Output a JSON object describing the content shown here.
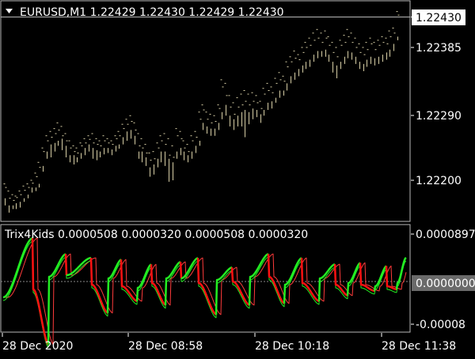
{
  "main_chart": {
    "menu_icon": "triangle-down-icon",
    "title": "EURUSD,M1  1.22429 1.22430 1.22429 1.22430",
    "current_price": "1.22430",
    "price_ticks": [
      "1.22385",
      "1.22290",
      "1.22200"
    ],
    "colors": {
      "bars": "#d8cfa6",
      "border": "#b9b9b9",
      "price_box": "#ffffff"
    },
    "bars": [
      [
        1.22195,
        1.22175,
        1.22165,
        1.2219
      ],
      [
        1.22185,
        1.22165,
        1.22155,
        1.22175
      ],
      [
        1.2218,
        1.22165,
        1.2216,
        1.22172
      ],
      [
        1.22178,
        1.22168,
        1.2216,
        1.22176
      ],
      [
        1.22185,
        1.2217,
        1.22162,
        1.2218
      ],
      [
        1.22192,
        1.22175,
        1.2217,
        1.22186
      ],
      [
        1.22195,
        1.2218,
        1.22175,
        1.2219
      ],
      [
        1.222,
        1.2219,
        1.22183,
        1.22196
      ],
      [
        1.2221,
        1.2219,
        1.22185,
        1.22205
      ],
      [
        1.22225,
        1.22195,
        1.2219,
        1.22218
      ],
      [
        1.22245,
        1.2222,
        1.22212,
        1.2224
      ],
      [
        1.22262,
        1.2224,
        1.2223,
        1.22255
      ],
      [
        1.22268,
        1.2225,
        1.22232,
        1.2226
      ],
      [
        1.22272,
        1.22252,
        1.2224,
        1.22265
      ],
      [
        1.2228,
        1.22255,
        1.22248,
        1.2227
      ],
      [
        1.22275,
        1.22258,
        1.22242,
        1.22262
      ],
      [
        1.22265,
        1.22248,
        1.22232,
        1.22255
      ],
      [
        1.22255,
        1.22235,
        1.22225,
        1.22245
      ],
      [
        1.22248,
        1.22235,
        1.22222,
        1.2224
      ],
      [
        1.22245,
        1.22232,
        1.22225,
        1.22238
      ],
      [
        1.22252,
        1.22238,
        1.2223,
        1.22248
      ],
      [
        1.22258,
        1.22245,
        1.22235,
        1.22252
      ],
      [
        1.22262,
        1.2225,
        1.2224,
        1.22257
      ],
      [
        1.22265,
        1.22245,
        1.2223,
        1.22252
      ],
      [
        1.22258,
        1.22242,
        1.22228,
        1.2225
      ],
      [
        1.22255,
        1.2224,
        1.22232,
        1.22248
      ],
      [
        1.22262,
        1.22245,
        1.22236,
        1.22255
      ],
      [
        1.22258,
        1.22245,
        1.22238,
        1.22252
      ],
      [
        1.22255,
        1.22243,
        1.22235,
        1.2225
      ],
      [
        1.22262,
        1.22248,
        1.2224,
        1.22258
      ],
      [
        1.22268,
        1.2225,
        1.22244,
        1.22262
      ],
      [
        1.22278,
        1.2226,
        1.2225,
        1.22272
      ],
      [
        1.22285,
        1.22268,
        1.22255,
        1.22278
      ],
      [
        1.2229,
        1.2227,
        1.22258,
        1.22282
      ],
      [
        1.2228,
        1.22262,
        1.2225,
        1.2227
      ],
      [
        1.22265,
        1.2224,
        1.2223,
        1.22248
      ],
      [
        1.22258,
        1.2224,
        1.22225,
        1.22245
      ],
      [
        1.2225,
        1.22232,
        1.2222,
        1.22238
      ],
      [
        1.22238,
        1.22218,
        1.22205,
        1.22228
      ],
      [
        1.2224,
        1.22222,
        1.22208,
        1.2223
      ],
      [
        1.22252,
        1.2223,
        1.22218,
        1.22245
      ],
      [
        1.22262,
        1.2224,
        1.22225,
        1.22255
      ],
      [
        1.22265,
        1.2224,
        1.2222,
        1.2225
      ],
      [
        1.22258,
        1.2223,
        1.22198,
        1.22235
      ],
      [
        1.22248,
        1.22225,
        1.222,
        1.22232
      ],
      [
        1.22272,
        1.2224,
        1.2223,
        1.22262
      ],
      [
        1.22268,
        1.22245,
        1.22235,
        1.22258
      ],
      [
        1.22255,
        1.2224,
        1.22228,
        1.22245
      ],
      [
        1.2225,
        1.22235,
        1.22225,
        1.2224
      ],
      [
        1.22262,
        1.2224,
        1.2223,
        1.22255
      ],
      [
        1.22268,
        1.22248,
        1.22238,
        1.2226
      ],
      [
        1.22295,
        1.22255,
        1.22248,
        1.22285
      ],
      [
        1.22305,
        1.2228,
        1.2227,
        1.22298
      ],
      [
        1.22295,
        1.22275,
        1.22265,
        1.22285
      ],
      [
        1.22292,
        1.22272,
        1.22262,
        1.2228
      ],
      [
        1.2229,
        1.22272,
        1.22262,
        1.22282
      ],
      [
        1.22305,
        1.2228,
        1.2227,
        1.223
      ],
      [
        1.2234,
        1.22295,
        1.22285,
        1.2233
      ],
      [
        1.22335,
        1.22305,
        1.2229,
        1.22318
      ],
      [
        1.22318,
        1.2229,
        1.22275,
        1.22302
      ],
      [
        1.22308,
        1.22285,
        1.2227,
        1.22292
      ],
      [
        1.22315,
        1.2229,
        1.22275,
        1.22302
      ],
      [
        1.2232,
        1.22295,
        1.22275,
        1.22305
      ],
      [
        1.22325,
        1.22298,
        1.2226,
        1.2231
      ],
      [
        1.2232,
        1.22295,
        1.22278,
        1.22305
      ],
      [
        1.22322,
        1.223,
        1.22285,
        1.2231
      ],
      [
        1.22318,
        1.22298,
        1.22288,
        1.22308
      ],
      [
        1.2231,
        1.22292,
        1.2228,
        1.223
      ],
      [
        1.22328,
        1.22298,
        1.2229,
        1.2232
      ],
      [
        1.22335,
        1.22308,
        1.22298,
        1.22325
      ],
      [
        1.2233,
        1.2231,
        1.223,
        1.22322
      ],
      [
        1.22342,
        1.22315,
        1.22308,
        1.22335
      ],
      [
        1.2235,
        1.22325,
        1.22315,
        1.2234
      ],
      [
        1.22345,
        1.22325,
        1.22318,
        1.22338
      ],
      [
        1.22365,
        1.22335,
        1.22325,
        1.22358
      ],
      [
        1.22372,
        1.22345,
        1.22335,
        1.22365
      ],
      [
        1.2238,
        1.2235,
        1.2234,
        1.2237
      ],
      [
        1.22375,
        1.22355,
        1.22345,
        1.22368
      ],
      [
        1.22385,
        1.2236,
        1.2235,
        1.22378
      ],
      [
        1.22392,
        1.22365,
        1.22355,
        1.22385
      ],
      [
        1.22398,
        1.22368,
        1.22358,
        1.22388
      ],
      [
        1.22405,
        1.22375,
        1.22365,
        1.22395
      ],
      [
        1.2241,
        1.2238,
        1.2237,
        1.22398
      ],
      [
        1.22405,
        1.2238,
        1.22372,
        1.22392
      ],
      [
        1.22408,
        1.22382,
        1.22372,
        1.22398
      ],
      [
        1.224,
        1.22375,
        1.22365,
        1.22388
      ],
      [
        1.22392,
        1.22365,
        1.2235,
        1.22378
      ],
      [
        1.22385,
        1.2236,
        1.22342,
        1.22372
      ],
      [
        1.22395,
        1.22365,
        1.22355,
        1.22388
      ],
      [
        1.22402,
        1.22372,
        1.22362,
        1.22392
      ],
      [
        1.2241,
        1.2238,
        1.2237,
        1.224
      ],
      [
        1.22405,
        1.22378,
        1.22368,
        1.22392
      ],
      [
        1.22398,
        1.22372,
        1.22362,
        1.22385
      ],
      [
        1.2239,
        1.22365,
        1.22355,
        1.22378
      ],
      [
        1.22385,
        1.22362,
        1.22352,
        1.22375
      ],
      [
        1.22392,
        1.22368,
        1.22358,
        1.22382
      ],
      [
        1.22398,
        1.22372,
        1.22362,
        1.2239
      ],
      [
        1.22392,
        1.2237,
        1.2236,
        1.22382
      ],
      [
        1.22395,
        1.22372,
        1.22362,
        1.22388
      ],
      [
        1.224,
        1.22375,
        1.22365,
        1.22392
      ],
      [
        1.22398,
        1.22378,
        1.22368,
        1.2239
      ],
      [
        1.22408,
        1.22382,
        1.22372,
        1.224
      ],
      [
        1.22412,
        1.2239,
        1.2238,
        1.22405
      ],
      [
        1.22435,
        1.224,
        1.22395,
        1.2243
      ]
    ]
  },
  "indicator": {
    "title": "Trix4Kids 0.0000508 0.0000320 0.0000508 0.0000320",
    "ticks": {
      "top": "0.0000897",
      "zero": "0.0000000",
      "bottom": "-0.00008"
    },
    "colors": {
      "up": "#22ee22",
      "down": "#ff1111",
      "signal": "#ff3b3b",
      "baseline": "#888888"
    },
    "waves": [
      {
        "s": 0,
        "p": -20,
        "e": 38,
        "a": 55
      },
      {
        "s": 38,
        "p": -10,
        "e": 58,
        "a": -80
      },
      {
        "s": 58,
        "p": 6,
        "e": 80,
        "a": 35
      },
      {
        "s": 80,
        "p": 8,
        "e": 112,
        "a": 30
      },
      {
        "s": 112,
        "p": -4,
        "e": 133,
        "a": -40
      },
      {
        "s": 133,
        "p": 4,
        "e": 150,
        "a": 28
      },
      {
        "s": 150,
        "p": -6,
        "e": 170,
        "a": -25
      },
      {
        "s": 170,
        "p": -8,
        "e": 188,
        "a": 22
      },
      {
        "s": 188,
        "p": -2,
        "e": 206,
        "a": -30
      },
      {
        "s": 206,
        "p": 4,
        "e": 225,
        "a": 25
      },
      {
        "s": 225,
        "p": 4,
        "e": 247,
        "a": 30
      },
      {
        "s": 247,
        "p": -2,
        "e": 270,
        "a": -42
      },
      {
        "s": 270,
        "p": 2,
        "e": 290,
        "a": 18
      },
      {
        "s": 290,
        "p": 0,
        "e": 312,
        "a": -30
      },
      {
        "s": 312,
        "p": 6,
        "e": 336,
        "a": 35
      },
      {
        "s": 336,
        "p": 6,
        "e": 356,
        "a": -28
      },
      {
        "s": 356,
        "p": -4,
        "e": 378,
        "a": 30
      },
      {
        "s": 378,
        "p": -2,
        "e": 400,
        "a": -25
      },
      {
        "s": 400,
        "p": 4,
        "e": 420,
        "a": 22
      },
      {
        "s": 420,
        "p": -4,
        "e": 436,
        "a": -18
      },
      {
        "s": 436,
        "p": -2,
        "e": 452,
        "a": 24
      },
      {
        "s": 452,
        "p": -4,
        "e": 470,
        "a": -12
      },
      {
        "s": 470,
        "p": -6,
        "e": 485,
        "a": 20
      },
      {
        "s": 485,
        "p": -6,
        "e": 498,
        "a": -10
      },
      {
        "s": 498,
        "p": -2,
        "e": 509,
        "a": 30
      }
    ]
  },
  "time_axis": {
    "labels": [
      "28 Dec 2020",
      "28 Dec 08:58",
      "28 Dec 10:18",
      "28 Dec 11:38"
    ]
  }
}
